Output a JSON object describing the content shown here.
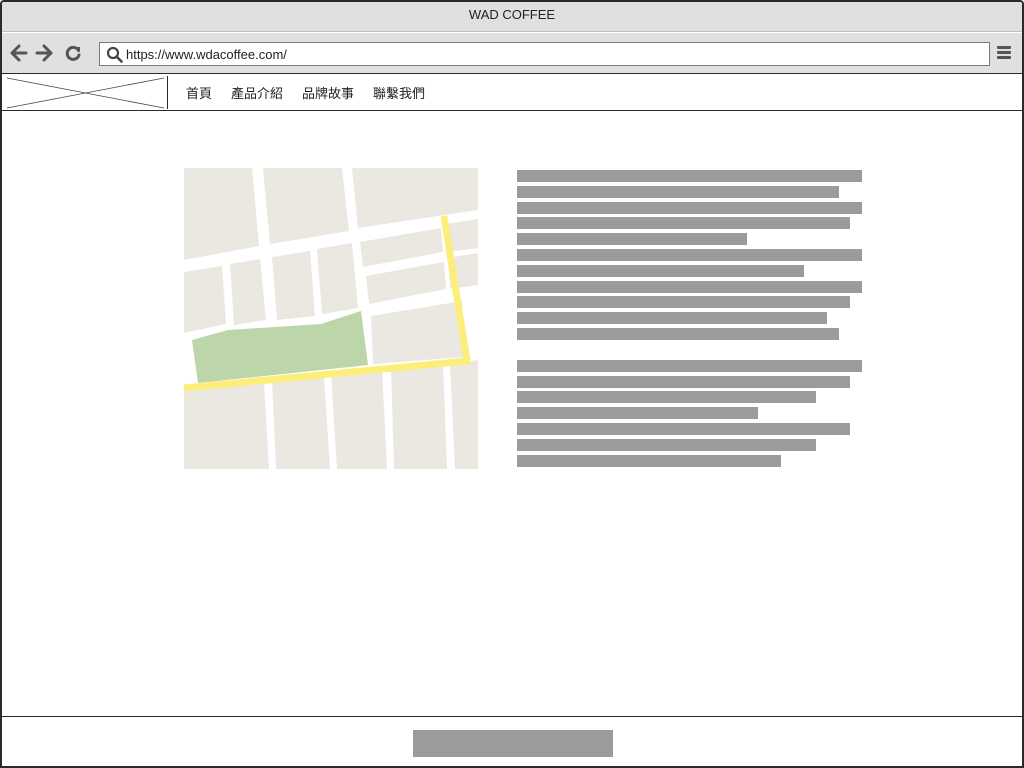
{
  "window": {
    "title": "WAD COFFEE"
  },
  "toolbar": {
    "url": "https://www.wdacoffee.com/",
    "back_icon": "arrow-left-icon",
    "forward_icon": "arrow-right-icon",
    "reload_icon": "reload-icon",
    "search_icon": "search-icon",
    "menu_icon": "hamburger-menu-icon"
  },
  "site": {
    "logo": "placeholder-image",
    "nav": [
      {
        "label": "首頁"
      },
      {
        "label": "產品介紹"
      },
      {
        "label": "品牌故事"
      },
      {
        "label": "聯繫我們"
      }
    ]
  },
  "content": {
    "map": "map-placeholder",
    "paragraphs": [
      {
        "lines": 11
      },
      {
        "lines": 7
      }
    ]
  },
  "colors": {
    "chrome": "#e0e0e0",
    "border": "#2a2a2a",
    "placeholder_text": "#9b9b9b",
    "map_land": "#ebe8e1",
    "map_park": "#bcd5a9",
    "map_route": "#fbee7a"
  }
}
